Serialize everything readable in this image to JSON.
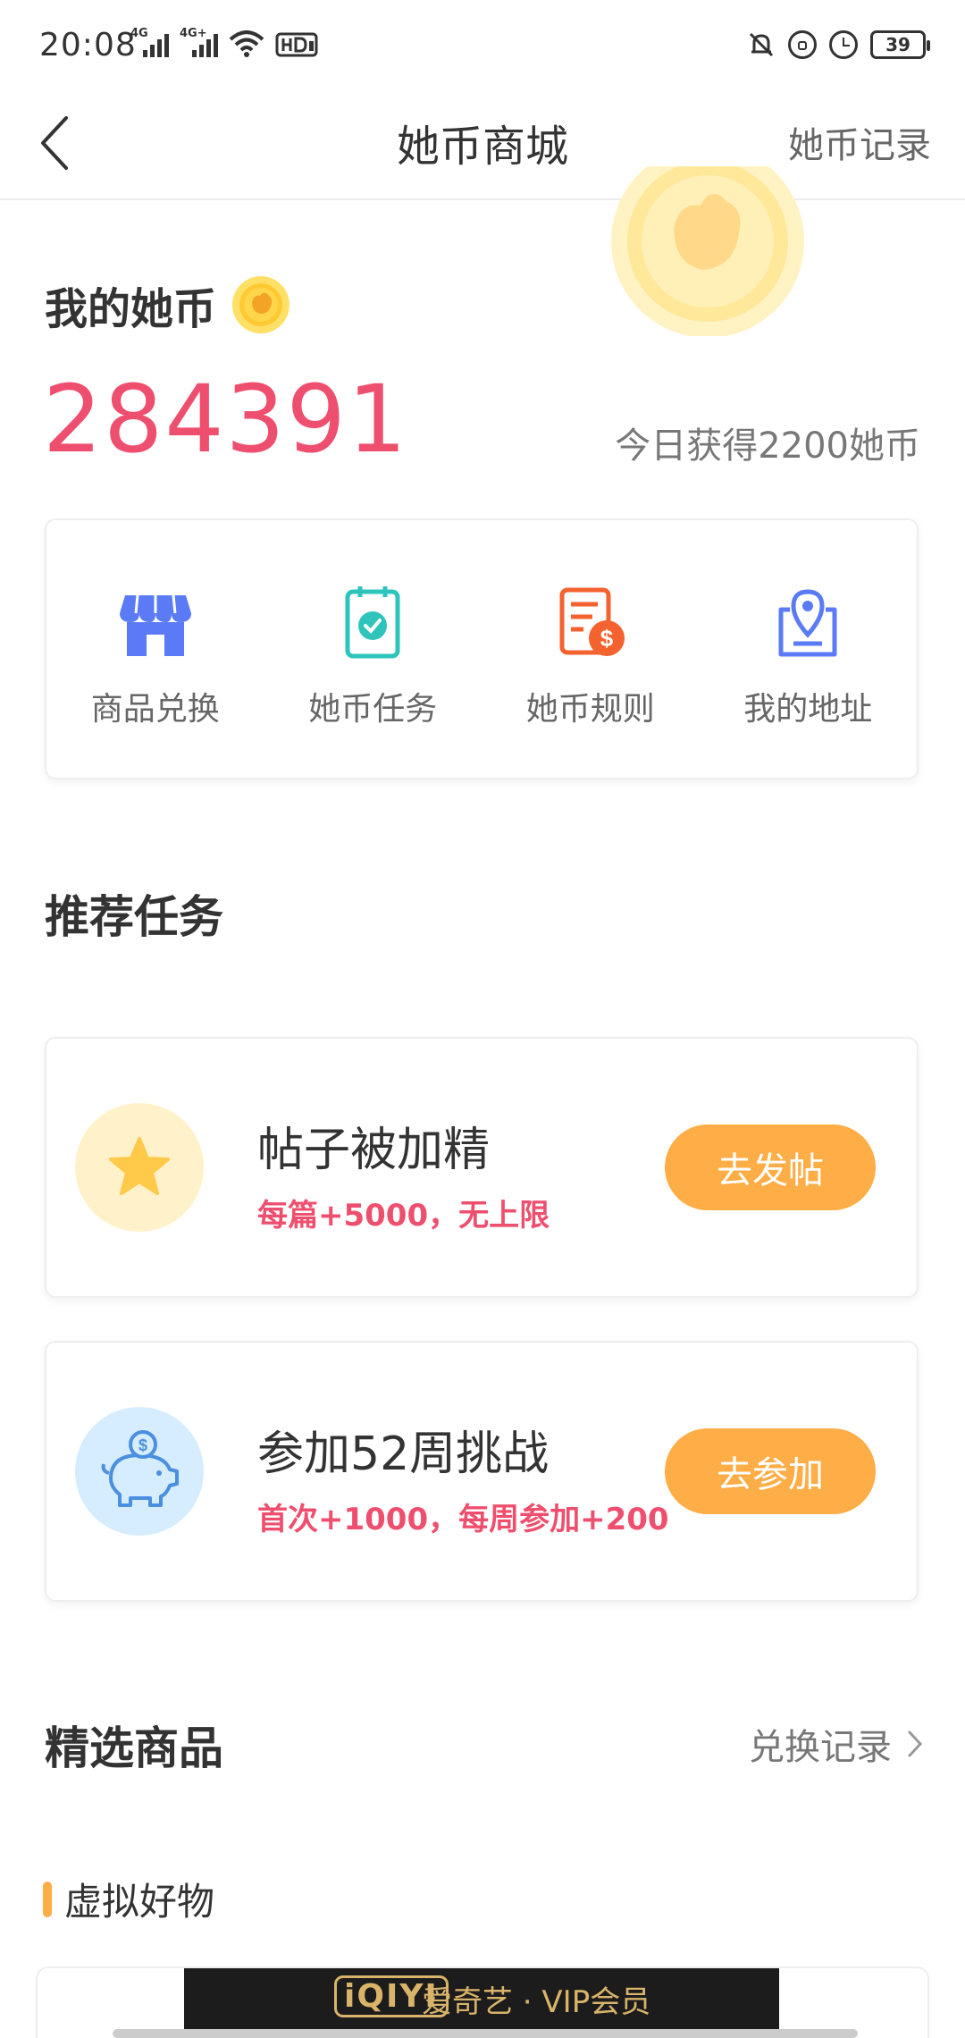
{
  "status_bar": {
    "time": "20:08",
    "signal_labels": [
      "4G",
      "4G+"
    ],
    "battery": "39"
  },
  "nav": {
    "title": "她币商城",
    "right_link": "她币记录"
  },
  "coins": {
    "title": "我的她币",
    "value": "284391",
    "today": "今日获得2200她币"
  },
  "menu": [
    {
      "label": "商品兑换",
      "icon": "store-icon",
      "color": "#5b7bf6"
    },
    {
      "label": "她币任务",
      "icon": "task-clipboard-icon",
      "color": "#2ec4bb"
    },
    {
      "label": "她币规则",
      "icon": "rules-document-icon",
      "color": "#f4622f"
    },
    {
      "label": "我的地址",
      "icon": "address-location-icon",
      "color": "#5b7bf6"
    }
  ],
  "recommended": {
    "title": "推荐任务",
    "tasks": [
      {
        "title": "帖子被加精",
        "subtitle": "每篇+5000，无上限",
        "button": "去发帖",
        "icon": "star-icon",
        "icon_bg": "#fff1c9"
      },
      {
        "title": "参加52周挑战",
        "subtitle": "首次+1000，每周参加+200",
        "button": "去参加",
        "icon": "piggy-bank-icon",
        "icon_bg": "#d6ecff"
      }
    ]
  },
  "featured": {
    "title": "精选商品",
    "link": "兑换记录",
    "subsection": "虚拟好物"
  },
  "product": {
    "logo": "iQIYI",
    "text": "爱奇艺 · VIP会员"
  },
  "colors": {
    "accent_red": "#ef4f6e",
    "button_orange": "#ffad46",
    "coin_gold": "#ffd24d"
  }
}
